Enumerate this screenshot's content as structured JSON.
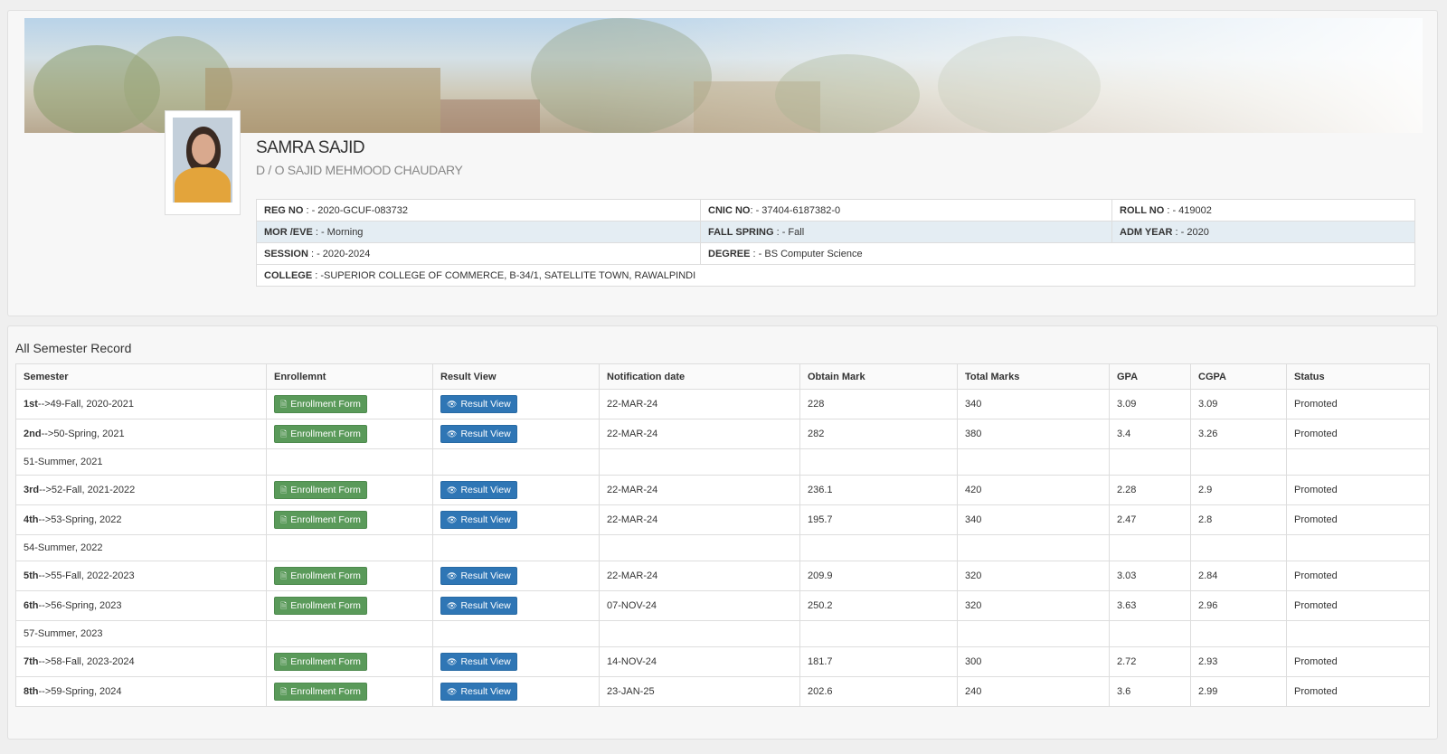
{
  "profile": {
    "name": "SAMRA SAJID",
    "parent": "D / O SAJID MEHMOOD CHAUDARY",
    "info": {
      "reg_label": "REG NO",
      "reg_value": " : - 2020-GCUF-083732",
      "cnic_label": "CNIC NO",
      "cnic_value": ": - 37404-6187382-0",
      "roll_label": "ROLL NO",
      "roll_value": " : - 419002",
      "shift_label": "MOR /EVE",
      "shift_value": " : - Morning",
      "fall_label": "FALL SPRING",
      "fall_value": " : - Fall",
      "adm_label": "ADM YEAR",
      "adm_value": " : - 2020",
      "session_label": "SESSION",
      "session_value": " : - 2020-2024",
      "degree_label": "DEGREE",
      "degree_value": " : - BS Computer Science",
      "college_label": "COLLEGE",
      "college_value": " : -SUPERIOR COLLEGE OF COMMERCE, B-34/1, SATELLITE TOWN, RAWALPINDI"
    }
  },
  "record": {
    "title": "All Semester Record",
    "headers": [
      "Semester",
      "Enrollemnt",
      "Result View",
      "Notification date",
      "Obtain Mark",
      "Total Marks",
      "GPA",
      "CGPA",
      "Status"
    ],
    "enroll_label": "Enrollment Form",
    "result_label": "Result View",
    "rows": [
      {
        "sem_bold": "1st",
        "sem_rest": "-->49-Fall, 2020-2021",
        "date": "22-MAR-24",
        "obtain": "228",
        "total": "340",
        "gpa": "3.09",
        "cgpa": "3.09",
        "status": "Promoted"
      },
      {
        "sem_bold": "2nd",
        "sem_rest": "-->50-Spring, 2021",
        "date": "22-MAR-24",
        "obtain": "282",
        "total": "380",
        "gpa": "3.4",
        "cgpa": "3.26",
        "status": "Promoted"
      },
      {
        "empty": true,
        "sem_rest": "51-Summer, 2021"
      },
      {
        "sem_bold": "3rd",
        "sem_rest": "-->52-Fall, 2021-2022",
        "date": "22-MAR-24",
        "obtain": "236.1",
        "total": "420",
        "gpa": "2.28",
        "cgpa": "2.9",
        "status": "Promoted"
      },
      {
        "sem_bold": "4th",
        "sem_rest": "-->53-Spring, 2022",
        "date": "22-MAR-24",
        "obtain": "195.7",
        "total": "340",
        "gpa": "2.47",
        "cgpa": "2.8",
        "status": "Promoted"
      },
      {
        "empty": true,
        "sem_rest": "54-Summer, 2022"
      },
      {
        "sem_bold": "5th",
        "sem_rest": "-->55-Fall, 2022-2023",
        "date": "22-MAR-24",
        "obtain": "209.9",
        "total": "320",
        "gpa": "3.03",
        "cgpa": "2.84",
        "status": "Promoted"
      },
      {
        "sem_bold": "6th",
        "sem_rest": "-->56-Spring, 2023",
        "date": "07-NOV-24",
        "obtain": "250.2",
        "total": "320",
        "gpa": "3.63",
        "cgpa": "2.96",
        "status": "Promoted"
      },
      {
        "empty": true,
        "sem_rest": "57-Summer, 2023"
      },
      {
        "sem_bold": "7th",
        "sem_rest": "-->58-Fall, 2023-2024",
        "date": "14-NOV-24",
        "obtain": "181.7",
        "total": "300",
        "gpa": "2.72",
        "cgpa": "2.93",
        "status": "Promoted"
      },
      {
        "sem_bold": "8th",
        "sem_rest": "-->59-Spring, 2024",
        "date": "23-JAN-25",
        "obtain": "202.6",
        "total": "240",
        "gpa": "3.6",
        "cgpa": "2.99",
        "status": "Promoted"
      }
    ]
  },
  "icons": {
    "enroll": "pdf-file-icon",
    "result": "eye-icon"
  },
  "colors": {
    "enroll_button": "#5a9a5a",
    "result_button": "#2f76b5",
    "info_alt_row": "#e4edf3"
  }
}
